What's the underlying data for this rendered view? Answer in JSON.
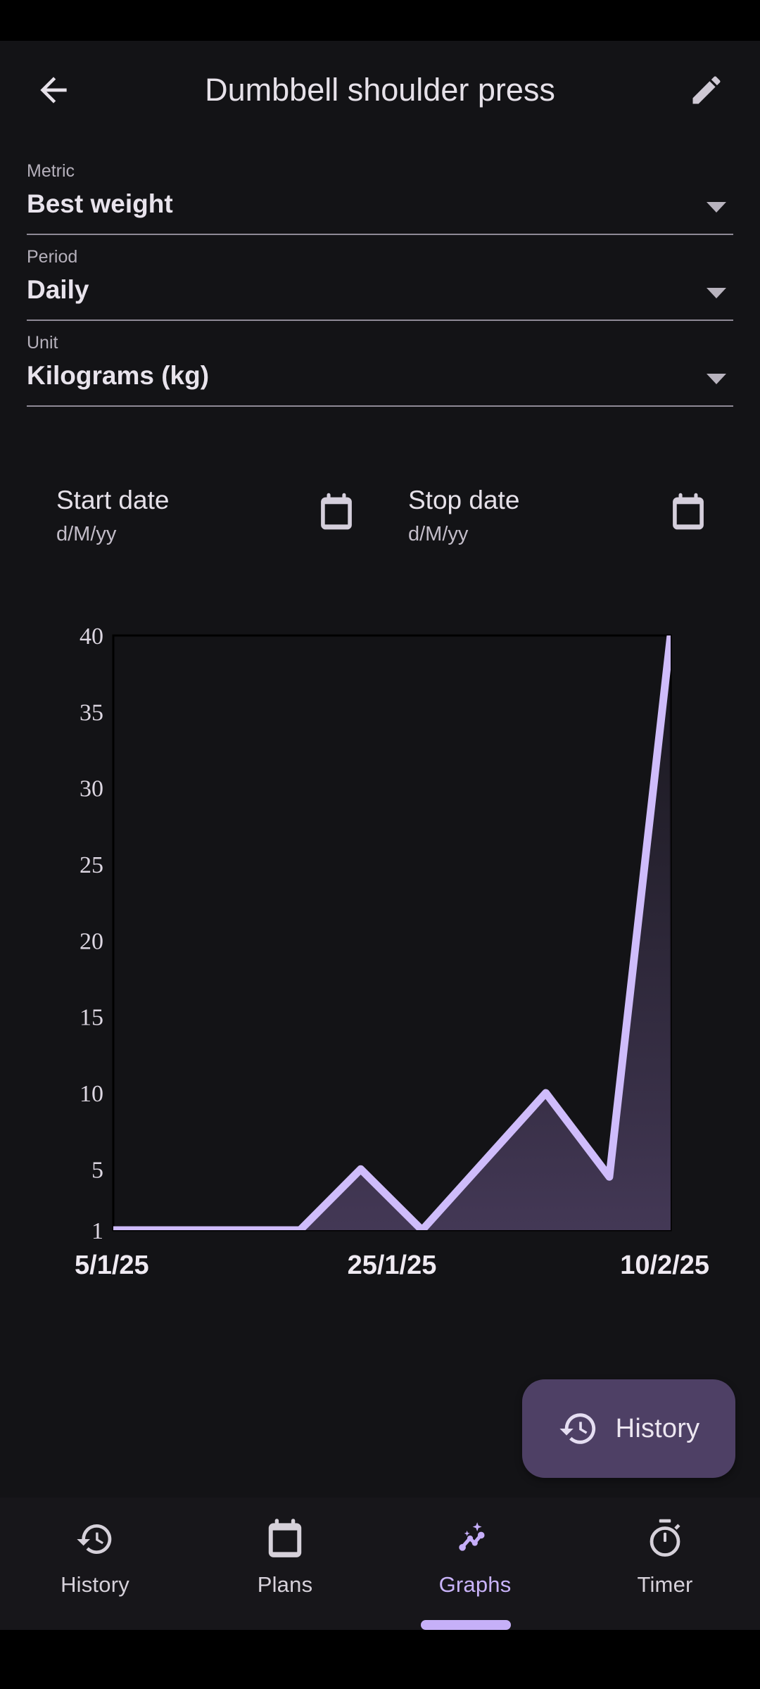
{
  "app": {
    "title": "Dumbbell shoulder press",
    "back_icon": "arrow-back-icon",
    "edit_icon": "pencil-edit-icon"
  },
  "selects": [
    {
      "label": "Metric",
      "value": "Best weight",
      "caret_icon": "chevron-down-icon"
    },
    {
      "label": "Period",
      "value": "Daily",
      "caret_icon": "chevron-down-icon"
    },
    {
      "label": "Unit",
      "value": "Kilograms (kg)",
      "caret_icon": "chevron-down-icon"
    }
  ],
  "date_range": {
    "start": {
      "title": "Start date",
      "hint": "d/M/yy",
      "icon": "calendar-icon"
    },
    "stop": {
      "title": "Stop date",
      "hint": "d/M/yy",
      "icon": "calendar-icon"
    }
  },
  "fab": {
    "label": "History",
    "icon": "history-clock-icon",
    "background": "#4e4065"
  },
  "bottom_nav": {
    "items": [
      {
        "label": "History",
        "icon": "history-clock-icon",
        "active": false
      },
      {
        "label": "Plans",
        "icon": "calendar-icon",
        "active": false
      },
      {
        "label": "Graphs",
        "icon": "query-stats-icon",
        "active": true
      },
      {
        "label": "Timer",
        "icon": "stopwatch-icon",
        "active": false
      }
    ],
    "active_color": "#c9b3fa",
    "inactive_color": "#d6d1da"
  },
  "chart_data": {
    "type": "line",
    "title": "",
    "xlabel": "",
    "ylabel": "",
    "line_color": "#cfbcfb",
    "fill_color": "#3a3048",
    "grid": false,
    "legend": false,
    "ylim": [
      1,
      40
    ],
    "ytick_labels": [
      "40",
      "35",
      "30",
      "25",
      "20",
      "15",
      "10",
      "5",
      "1"
    ],
    "ytick_values": [
      40,
      35,
      30,
      25,
      20,
      15,
      10,
      5,
      1
    ],
    "xtick_labels": [
      "5/1/25",
      "25/1/25",
      "10/2/25"
    ],
    "x": [
      "5/1/25",
      "13/1/25",
      "16/1/25",
      "20/1/25",
      "25/1/25",
      "30/1/25",
      "4/2/25",
      "10/2/25"
    ],
    "values": [
      1,
      1,
      1,
      5,
      1,
      10,
      4.5,
      40
    ],
    "points": [
      {
        "x_frac": 0.0,
        "value": 1
      },
      {
        "x_frac": 0.335,
        "value": 1
      },
      {
        "x_frac": 0.444,
        "value": 5
      },
      {
        "x_frac": 0.554,
        "value": 1
      },
      {
        "x_frac": 0.776,
        "value": 10
      },
      {
        "x_frac": 0.89,
        "value": 4.5
      },
      {
        "x_frac": 1.0,
        "value": 40
      }
    ]
  }
}
